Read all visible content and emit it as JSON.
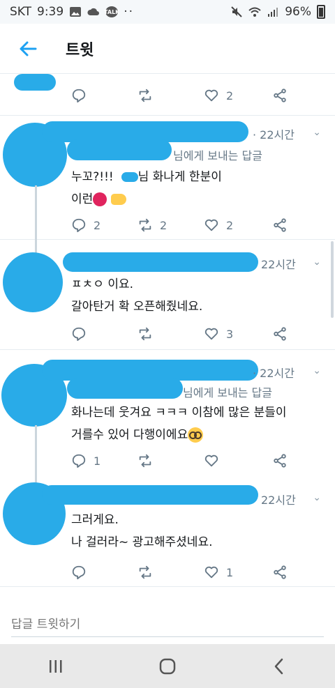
{
  "status_bar": {
    "carrier": "SKT",
    "time": "9:39",
    "battery": "96%",
    "icons": [
      "image-icon",
      "cloud-icon",
      "talk-icon",
      "more-dots-icon",
      "mute-icon",
      "wifi-icon",
      "signal-icon",
      "battery-icon"
    ]
  },
  "header": {
    "title": "트윗",
    "back_icon": "back-arrow-icon"
  },
  "tweets": [
    {
      "reply_count": "",
      "retweet_count": "",
      "like_count": "2"
    },
    {
      "time": "22시간",
      "reply_to": "님에게 보내는 답글",
      "line1_prefix": "누꼬?!!!",
      "line1_suffix": "님 화나게 한분이",
      "line2": "이런",
      "reply_count": "2",
      "retweet_count": "2",
      "like_count": "2"
    },
    {
      "time": "22시간",
      "line1": "ㅍㅊㅇ 이요.",
      "line2": "갈아탄거 확 오픈해줬네요.",
      "reply_count": "",
      "retweet_count": "",
      "like_count": "3"
    },
    {
      "time": "22시간",
      "reply_to": "님에게 보내는 답글",
      "line1": "화나는데 웃겨요 ㅋㅋㅋ 이참에 많은 분들이",
      "line2": "거를수 있어 다행이에요",
      "reply_count": "1",
      "retweet_count": "",
      "like_count": ""
    },
    {
      "time": "22시간",
      "line1": "그러게요.",
      "line2": "나 걸러라~ 광고해주셨네요.",
      "reply_count": "",
      "retweet_count": "",
      "like_count": "1"
    }
  ],
  "compose": {
    "placeholder": "답글 트윗하기"
  },
  "nav": {
    "icons": [
      "recent-apps-icon",
      "home-icon",
      "back-icon"
    ]
  },
  "colors": {
    "accent": "#1da1f2",
    "redaction": "#29abe8",
    "secondary_text": "#657786"
  }
}
